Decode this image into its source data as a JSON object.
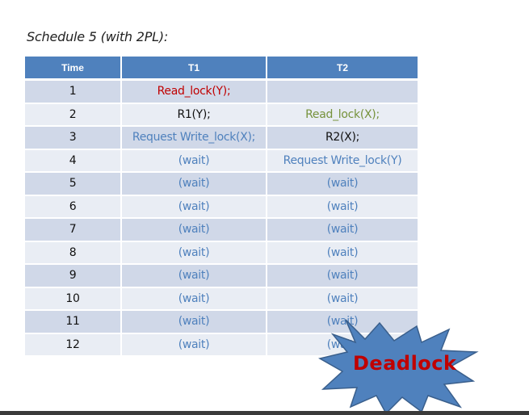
{
  "caption": "Schedule 5 (with 2PL):",
  "table": {
    "headers": [
      "Time",
      "T1",
      "T2"
    ],
    "rows": [
      {
        "time": "1",
        "t1": "Read_lock(Y);",
        "t1_color": "red",
        "t2": "",
        "t2_color": "black"
      },
      {
        "time": "2",
        "t1": "R1(Y);",
        "t1_color": "black",
        "t2": "Read_lock(X);",
        "t2_color": "green"
      },
      {
        "time": "3",
        "t1": "Request Write_lock(X);",
        "t1_color": "blue",
        "t2": "R2(X);",
        "t2_color": "black"
      },
      {
        "time": "4",
        "t1": "(wait)",
        "t1_color": "blue",
        "t2": "Request Write_lock(Y)",
        "t2_color": "blue"
      },
      {
        "time": "5",
        "t1": "(wait)",
        "t1_color": "blue",
        "t2": "(wait)",
        "t2_color": "blue"
      },
      {
        "time": "6",
        "t1": "(wait)",
        "t1_color": "blue",
        "t2": "(wait)",
        "t2_color": "blue"
      },
      {
        "time": "7",
        "t1": "(wait)",
        "t1_color": "blue",
        "t2": "(wait)",
        "t2_color": "blue"
      },
      {
        "time": "8",
        "t1": "(wait)",
        "t1_color": "blue",
        "t2": "(wait)",
        "t2_color": "blue"
      },
      {
        "time": "9",
        "t1": "(wait)",
        "t1_color": "blue",
        "t2": "(wait)",
        "t2_color": "blue"
      },
      {
        "time": "10",
        "t1": "(wait)",
        "t1_color": "blue",
        "t2": "(wait)",
        "t2_color": "blue"
      },
      {
        "time": "11",
        "t1": "(wait)",
        "t1_color": "blue",
        "t2": "(wait)",
        "t2_color": "blue"
      },
      {
        "time": "12",
        "t1": "(wait)",
        "t1_color": "blue",
        "t2": "(wait)",
        "t2_color": "blue"
      }
    ]
  },
  "callout": {
    "label": "Deadlock",
    "shape": "starburst-icon",
    "fill_color": "#4f81bd",
    "text_color": "#c00000"
  },
  "colors": {
    "header_bg": "#4f81bd",
    "row_odd_bg": "#d0d8e8",
    "row_even_bg": "#e9edf4",
    "red": "#c00000",
    "green": "#76923c",
    "blue": "#4f81bd"
  }
}
